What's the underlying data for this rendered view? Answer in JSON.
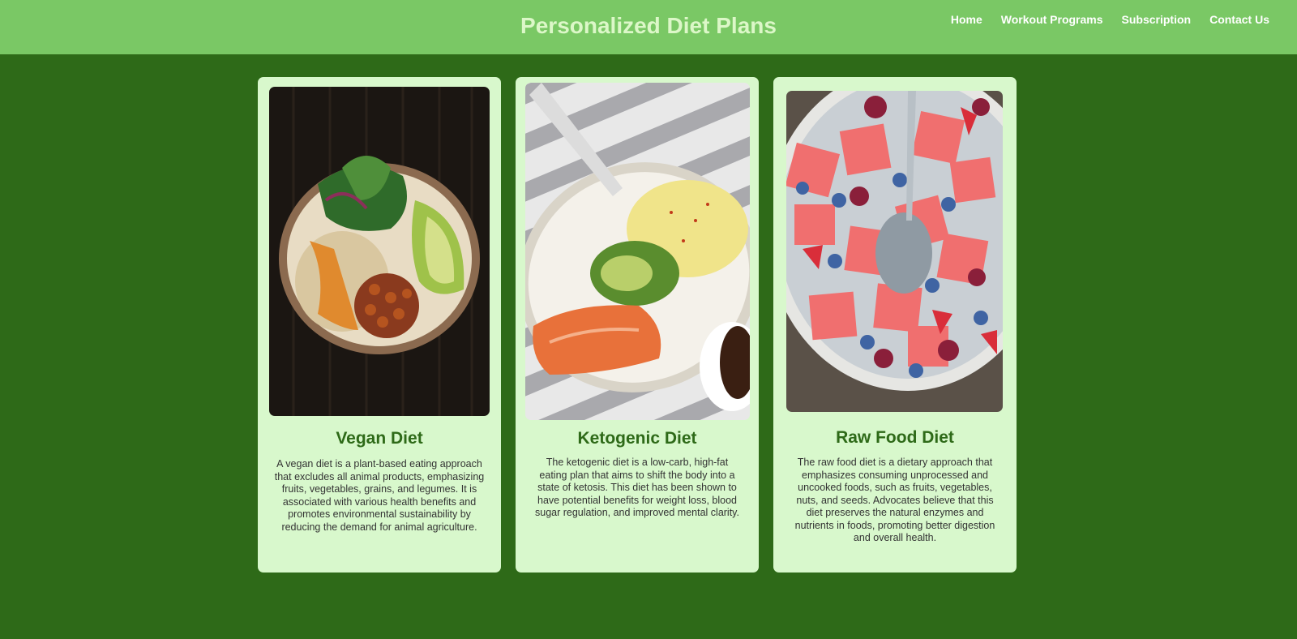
{
  "header": {
    "title": "Personalized Diet Plans",
    "nav": [
      "Home",
      "Workout Programs",
      "Subscription",
      "Contact Us"
    ]
  },
  "cards": [
    {
      "title": "Vegan Diet",
      "image": "vegan-bowl-photo",
      "description": "A vegan diet is a plant-based eating approach that excludes all animal products, emphasizing fruits, vegetables, grains, and legumes. It is associated with various health benefits and promotes environmental sustainability by reducing the demand for animal agriculture."
    },
    {
      "title": "Ketogenic Diet",
      "image": "keto-plate-photo",
      "description": "The ketogenic diet is a low-carb, high-fat eating plan that aims to shift the body into a state of ketosis. This diet has been shown to have potential benefits for weight loss, blood sugar regulation, and improved mental clarity."
    },
    {
      "title": "Raw Food Diet",
      "image": "fruit-bowl-photo",
      "description": "The raw food diet is a dietary approach that emphasizes consuming unprocessed and uncooked foods, such as fruits, vegetables, nuts, and seeds. Advocates believe that this diet preserves the natural enzymes and nutrients in foods, promoting better digestion and overall health."
    }
  ],
  "colors": {
    "background": "#2e6a18",
    "header": "#7ac865",
    "card": "#d8f8cc",
    "accent_text": "#2e6a18"
  }
}
